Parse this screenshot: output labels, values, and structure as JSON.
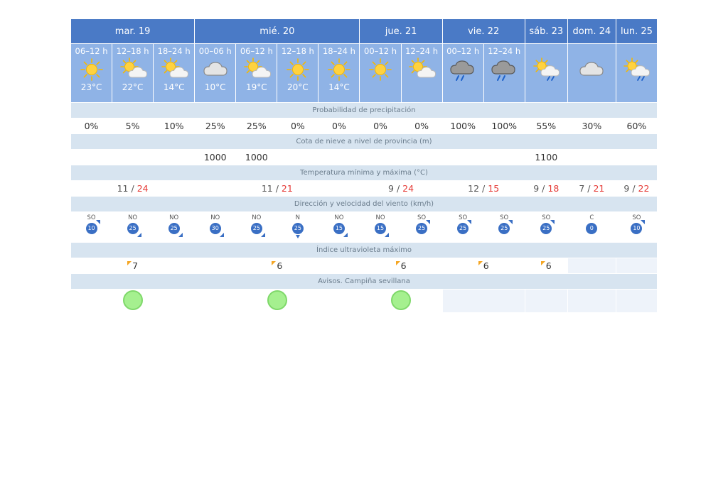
{
  "days": [
    {
      "label": "mar. 19",
      "periods": [
        {
          "label": "06–12 h",
          "icon": "sun-icon",
          "temp": "23°C"
        },
        {
          "label": "12–18 h",
          "icon": "sun-cloud-icon",
          "temp": "22°C"
        },
        {
          "label": "18–24 h",
          "icon": "sun-cloud-icon",
          "temp": "14°C"
        }
      ]
    },
    {
      "label": "mié. 20",
      "periods": [
        {
          "label": "00–06 h",
          "icon": "cloud-icon",
          "temp": "10°C"
        },
        {
          "label": "06–12 h",
          "icon": "sun-cloud-icon",
          "temp": "19°C"
        },
        {
          "label": "12–18 h",
          "icon": "sun-icon",
          "temp": "20°C"
        },
        {
          "label": "18–24 h",
          "icon": "sun-icon",
          "temp": "14°C"
        }
      ]
    },
    {
      "label": "jue. 21",
      "periods": [
        {
          "label": "00–12 h",
          "icon": "sun-icon",
          "temp": ""
        },
        {
          "label": "12–24 h",
          "icon": "sun-cloud-icon",
          "temp": ""
        }
      ]
    },
    {
      "label": "vie. 22",
      "periods": [
        {
          "label": "00–12 h",
          "icon": "storm-rain-icon",
          "temp": ""
        },
        {
          "label": "12–24 h",
          "icon": "storm-rain-icon",
          "temp": ""
        }
      ]
    },
    {
      "label": "sáb. 23",
      "periods": [
        {
          "label": "",
          "icon": "sun-cloud-rain-icon",
          "temp": ""
        }
      ]
    },
    {
      "label": "dom. 24",
      "periods": [
        {
          "label": "",
          "icon": "cloud-icon",
          "temp": ""
        }
      ]
    },
    {
      "label": "lun. 25",
      "periods": [
        {
          "label": "",
          "icon": "sun-cloud-rain-icon",
          "temp": ""
        }
      ]
    }
  ],
  "sections": {
    "precip": "Probabilidad de precipitación",
    "snow": "Cota de nieve a nivel de provincia (m)",
    "temp": "Temperatura mínima y máxima (°C)",
    "wind": "Dirección y velocidad del viento (km/h)",
    "uv": "Índice ultravioleta máximo",
    "warnings": "Avisos. Campiña sevillana"
  },
  "precip": [
    "0%",
    "5%",
    "10%",
    "25%",
    "25%",
    "0%",
    "0%",
    "0%",
    "0%",
    "100%",
    "100%",
    "55%",
    "30%",
    "60%"
  ],
  "snow": [
    "",
    "",
    "",
    "1000",
    "1000",
    "",
    "",
    "",
    "",
    "",
    "",
    "1100",
    "",
    ""
  ],
  "temps": [
    {
      "min": "11",
      "max": "24"
    },
    {
      "min": "11",
      "max": "21"
    },
    {
      "min": "9",
      "max": "24"
    },
    {
      "min": "12",
      "max": "15"
    },
    {
      "min": "9",
      "max": "18"
    },
    {
      "min": "7",
      "max": "21"
    },
    {
      "min": "9",
      "max": "22"
    }
  ],
  "temp_separator": " / ",
  "wind": [
    {
      "dir": "SO",
      "speed": "10"
    },
    {
      "dir": "NO",
      "speed": "25"
    },
    {
      "dir": "NO",
      "speed": "25"
    },
    {
      "dir": "NO",
      "speed": "30"
    },
    {
      "dir": "NO",
      "speed": "25"
    },
    {
      "dir": "N",
      "speed": "25"
    },
    {
      "dir": "NO",
      "speed": "15"
    },
    {
      "dir": "NO",
      "speed": "15"
    },
    {
      "dir": "SO",
      "speed": "25"
    },
    {
      "dir": "SO",
      "speed": "25"
    },
    {
      "dir": "SO",
      "speed": "25"
    },
    {
      "dir": "SO",
      "speed": "25"
    },
    {
      "dir": "C",
      "speed": "0"
    },
    {
      "dir": "SO",
      "speed": "10"
    }
  ],
  "uv": [
    "7",
    "6",
    "6",
    "6",
    "6",
    "",
    ""
  ],
  "warnings": [
    "green",
    "green",
    "green",
    "",
    "",
    "",
    ""
  ],
  "colors": {
    "day_header": "#4a7ac6",
    "period_bg": "#8fb3e6",
    "section_bg": "#d7e4f0",
    "temp_max": "#e53935",
    "wind_badge": "#3a6fc4",
    "uv_flag": "#f5a623",
    "warning_green": "#a5f08f"
  }
}
